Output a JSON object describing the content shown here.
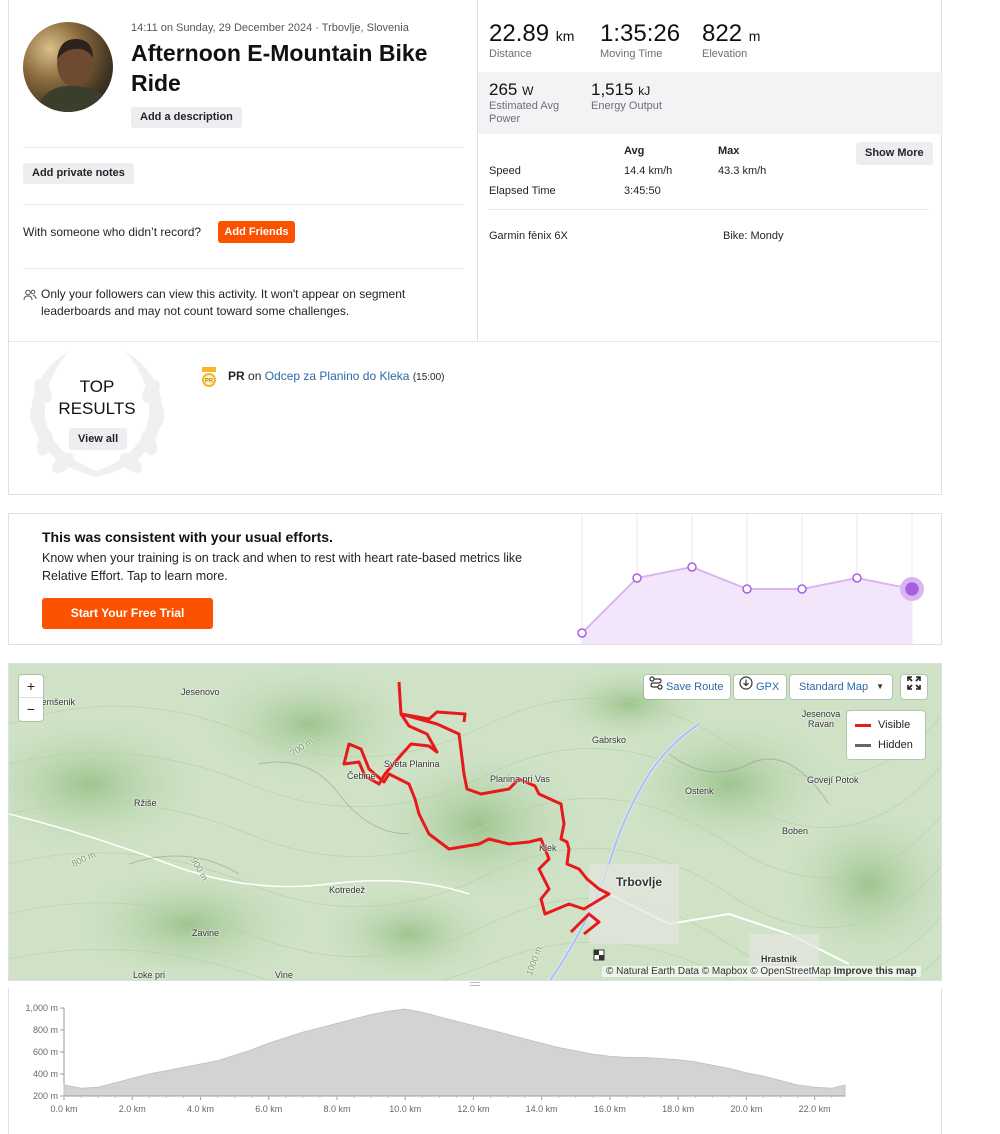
{
  "activity": {
    "meta": "14:11 on Sunday, 29 December 2024 · Trbovlje, Slovenia",
    "title": "Afternoon E-Mountain Bike Ride",
    "add_description": "Add a description",
    "add_private_notes": "Add private notes",
    "with_someone": "With someone who didn’t record?",
    "add_friends": "Add Friends",
    "privacy_note": "Only your followers can view this activity. It won't appear on segment leaderboards and may not count toward some challenges."
  },
  "stats": {
    "primary": [
      {
        "value": "22.89",
        "unit": "km",
        "label": "Distance"
      },
      {
        "value": "1:35:26",
        "unit": "",
        "label": "Moving Time"
      },
      {
        "value": "822",
        "unit": "m",
        "label": "Elevation"
      }
    ],
    "secondary": [
      {
        "value": "265",
        "unit": "W",
        "label": "Estimated Avg Power"
      },
      {
        "value": "1,515",
        "unit": "kJ",
        "label": "Energy Output"
      }
    ],
    "table": {
      "headers": [
        "Avg",
        "Max"
      ],
      "rows": [
        {
          "label": "Speed",
          "avg": "14.4 km/h",
          "max": "43.3 km/h"
        },
        {
          "label": "Elapsed Time",
          "avg": "3:45:50",
          "max": ""
        }
      ],
      "show_more": "Show More"
    },
    "device": "Garmin fēnix 6X",
    "bike": "Bike: Mondy"
  },
  "top_results": {
    "title_line1": "TOP",
    "title_line2": "RESULTS",
    "view_all": "View all",
    "badge": "PR",
    "pr_label": "PR",
    "pr_on": "on",
    "segment": "Odcep za Planino do Kleka",
    "segment_time": "(15:00)"
  },
  "consistency": {
    "heading": "This was consistent with your usual efforts.",
    "body": "Know when your training is on track and when to rest with heart rate-based metrics like Relative Effort. Tap to learn more.",
    "cta": "Start Your Free Trial"
  },
  "map": {
    "zoom_in": "+",
    "zoom_out": "−",
    "save_route": "Save Route",
    "gpx": "GPX",
    "map_style": "Standard Map",
    "legend": {
      "visible": "Visible",
      "hidden": "Hidden"
    },
    "labels": [
      "Jesenovo",
      "Čemšenik",
      "Čebine",
      "Sveta Planina",
      "Planina pri Vas",
      "Gabrsko",
      "Jesenova Ravan",
      "Govejí Potok",
      "Ostenk",
      "Boben",
      "Ržiše",
      "Kotredež",
      "Trbovlje",
      "Zavine",
      "Vine",
      "Hrastnik",
      "Lokе pri",
      "Klek",
      "700 m",
      "800 m",
      "900 m",
      "1000 m"
    ],
    "attribution": "© Natural Earth Data © Mapbox © OpenStreetMap",
    "improve": "Improve this map",
    "colors": {
      "route": "#e8191b",
      "hidden": "#666666"
    }
  },
  "chart_data": {
    "type": "area",
    "x": [
      0.0,
      0.5,
      1.0,
      1.5,
      2.0,
      2.5,
      3.0,
      3.5,
      4.0,
      4.5,
      5.0,
      5.5,
      6.0,
      6.5,
      7.0,
      7.5,
      8.0,
      8.5,
      9.0,
      9.5,
      10.0,
      10.5,
      11.0,
      11.5,
      12.0,
      12.5,
      13.0,
      13.5,
      14.0,
      14.5,
      15.0,
      15.5,
      16.0,
      16.5,
      17.0,
      17.5,
      18.0,
      18.5,
      19.0,
      19.5,
      20.0,
      20.5,
      21.0,
      21.5,
      22.0,
      22.5,
      22.89
    ],
    "y": [
      300,
      270,
      280,
      320,
      360,
      400,
      430,
      460,
      490,
      520,
      570,
      620,
      680,
      730,
      780,
      820,
      860,
      900,
      940,
      970,
      990,
      960,
      920,
      880,
      840,
      800,
      760,
      720,
      680,
      640,
      610,
      580,
      560,
      550,
      550,
      540,
      530,
      510,
      480,
      450,
      410,
      380,
      340,
      300,
      280,
      270,
      300
    ],
    "yticks": [
      "1,000 m",
      "800 m",
      "600 m",
      "400 m",
      "200 m"
    ],
    "xticks": [
      "0.0 km",
      "2.0 km",
      "4.0 km",
      "6.0 km",
      "8.0 km",
      "10.0 km",
      "12.0 km",
      "14.0 km",
      "16.0 km",
      "18.0 km",
      "20.0 km",
      "22.0 km"
    ],
    "xlim": [
      0,
      22.89
    ],
    "ylim": [
      200,
      1000
    ],
    "fill": "#d3d3d3"
  },
  "effort_chart": {
    "type": "line",
    "values": [
      1,
      6,
      7,
      5,
      5,
      6,
      5
    ],
    "ylim": [
      0,
      10
    ],
    "color": "#a95ee0"
  }
}
